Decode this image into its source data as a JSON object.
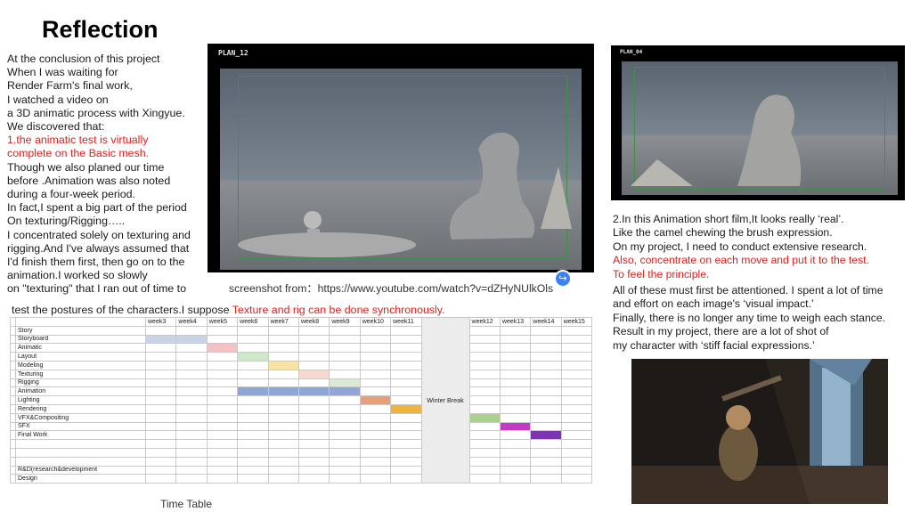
{
  "title": "Reflection",
  "left_lines": [
    {
      "text": "At the conclusion of this project",
      "red": false
    },
    {
      "text": "When I was waiting for",
      "red": false
    },
    {
      "text": "Render Farm's final work,",
      "red": false
    },
    {
      "text": "I watched a video on",
      "red": false
    },
    {
      "text": "a 3D animatic process with Xingyue.",
      "red": false
    },
    {
      "text": "We discovered that:",
      "red": false
    },
    {
      "text": "1.the animatic test is virtually",
      "red": "partial"
    },
    {
      "text": "complete on the Basic mesh.",
      "red": true
    },
    {
      "text": "Though we also planed our time",
      "red": false
    },
    {
      "text": "before .Animation was also noted",
      "red": false
    },
    {
      "text": "during a four-week period.",
      "red": false
    },
    {
      "text": "In fact,I spent a big part of the period",
      "red": false
    },
    {
      "text": " On texturing/Rigging…..",
      "red": false
    },
    {
      "text": "I concentrated solely on texturing and",
      "red": false
    },
    {
      "text": "rigging.And I've always assumed that",
      "red": false
    },
    {
      "text": "I'd finish them first, then go on to the",
      "red": false
    },
    {
      "text": "animation.I worked so slowly",
      "red": false
    },
    {
      "text": "on \"texturing\" that I ran out of time to",
      "red": false
    }
  ],
  "red_prefix": "1.",
  "red_rest": "the animatic test is virtually",
  "bottom_line_black": "test the postures of the characters.I suppose ",
  "bottom_line_red": "Texture and rig can be done synchronously.",
  "frame1_label": "PLAN_12",
  "frame2_label": "PLAN_04",
  "screenshot_caption": "screenshot from：https://www.youtube.com/watch?v=dZHyNUlkOls",
  "right_lines": [
    {
      "text": "2.In this Animation short film,It looks really ‘real’.",
      "red": false
    },
    {
      "text": "Like the camel chewing the brush expression.",
      "red": false
    },
    {
      "text": "On my project, I need to conduct extensive research.",
      "red": false
    },
    {
      "text": "Also, concentrate on each move and put it to the test.",
      "red": true
    },
    {
      "text": "To feel the principle.",
      "red": true
    },
    {
      "text": "",
      "red": false
    },
    {
      "text": "All of these must first be attentioned. I spent a lot of time",
      "red": false
    },
    {
      "text": "and effort on each image's ‘visual impact.’",
      "red": false
    },
    {
      "text": "Finally, there is no longer any time to weigh each stance.",
      "red": false
    },
    {
      "text": "Result in my project, there are a lot of shot of",
      "red": false
    },
    {
      "text": "my character with ‘stiff facial expressions.’",
      "red": false
    }
  ],
  "timetable": {
    "caption": "Time Table",
    "weeks_a": [
      "week3",
      "week4",
      "week5",
      "week6",
      "week7",
      "week8",
      "week9",
      "week10",
      "week11"
    ],
    "weeks_b": [
      "week12",
      "week13",
      "week14",
      "week15"
    ],
    "winter_break": "Winter Break",
    "tasks": [
      "Story",
      "Storyboard",
      "Animatic",
      "Layout",
      "Modeling",
      "Texturing",
      "Rigging",
      "Animation",
      "Lighting",
      "Rendering",
      "VFX&Compositing",
      "SFX",
      "Final Work",
      "",
      "",
      "",
      "R&D(research&development",
      "Design"
    ],
    "bars": [
      {
        "task": 1,
        "from": 0,
        "to": 1,
        "color": "#c8d3ea"
      },
      {
        "task": 2,
        "from": 2,
        "to": 2,
        "color": "#f4c2c6"
      },
      {
        "task": 3,
        "from": 3,
        "to": 3,
        "color": "#cfe8c9"
      },
      {
        "task": 4,
        "from": 4,
        "to": 4,
        "color": "#f7e3a6"
      },
      {
        "task": 5,
        "from": 5,
        "to": 5,
        "color": "#f6d9cf"
      },
      {
        "task": 6,
        "from": 6,
        "to": 6,
        "color": "#dbe9d3"
      },
      {
        "task": 7,
        "from": 3,
        "to": 6,
        "color": "#8fa6d6"
      },
      {
        "task": 8,
        "from": 7,
        "to": 7,
        "color": "#e8a07a"
      },
      {
        "task": 9,
        "from": 8,
        "to": 8,
        "color": "#edb63a"
      },
      {
        "task": 10,
        "from": 9,
        "to": 9,
        "color": "#a9d18e"
      },
      {
        "task": 11,
        "from": 10,
        "to": 10,
        "color": "#c23bc4"
      },
      {
        "task": 12,
        "from": 11,
        "to": 11,
        "color": "#7c35b0"
      }
    ]
  },
  "colors": {
    "accent_red": "#e0201b"
  }
}
